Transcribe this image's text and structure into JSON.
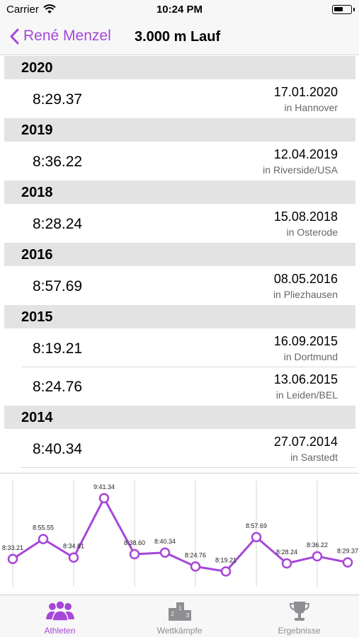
{
  "status_bar": {
    "carrier": "Carrier",
    "time": "10:24 PM",
    "battery_level": 0.55
  },
  "nav": {
    "back_label": "René Menzel",
    "title": "3.000 m Lauf"
  },
  "sections": [
    {
      "year": "2020",
      "results": [
        {
          "time": "8:29.37",
          "date": "17.01.2020",
          "place": "in Hannover"
        }
      ]
    },
    {
      "year": "2019",
      "results": [
        {
          "time": "8:36.22",
          "date": "12.04.2019",
          "place": "in Riverside/USA"
        }
      ]
    },
    {
      "year": "2018",
      "results": [
        {
          "time": "8:28.24",
          "date": "15.08.2018",
          "place": "in Osterode"
        }
      ]
    },
    {
      "year": "2016",
      "results": [
        {
          "time": "8:57.69",
          "date": "08.05.2016",
          "place": "in Pliezhausen"
        }
      ]
    },
    {
      "year": "2015",
      "results": [
        {
          "time": "8:19.21",
          "date": "16.09.2015",
          "place": "in Dortmund"
        },
        {
          "time": "8:24.76",
          "date": "13.06.2015",
          "place": "in Leiden/BEL"
        }
      ]
    },
    {
      "year": "2014",
      "results": [
        {
          "time": "8:40.34",
          "date": "27.07.2014",
          "place": "in Sarstedt"
        }
      ]
    }
  ],
  "chart_data": {
    "type": "line",
    "values": [
      513.21,
      535.55,
      514.81,
      581.34,
      518.6,
      520.34,
      504.76,
      499.21,
      537.69,
      508.24,
      516.22,
      509.37
    ],
    "labels": [
      "8:33.21",
      "8:55.55",
      "8:34.81",
      "9:41.34",
      "8:38.60",
      "8:40.34",
      "8:24.76",
      "8:19.21",
      "8:57.69",
      "8:28.24",
      "8:36.22",
      "8:29.37"
    ],
    "ylim": [
      490,
      590
    ],
    "grid": true,
    "line_color": "#a646d8"
  },
  "tabs": [
    {
      "label": "Athleten",
      "icon": "people-icon",
      "active": true
    },
    {
      "label": "Wettkämpfe",
      "icon": "podium-icon",
      "active": false
    },
    {
      "label": "Ergebnisse",
      "icon": "trophy-icon",
      "active": false
    }
  ],
  "colors": {
    "accent": "#a646d8",
    "inactive": "#8e8e93",
    "section_bg": "#e3e3e3"
  }
}
